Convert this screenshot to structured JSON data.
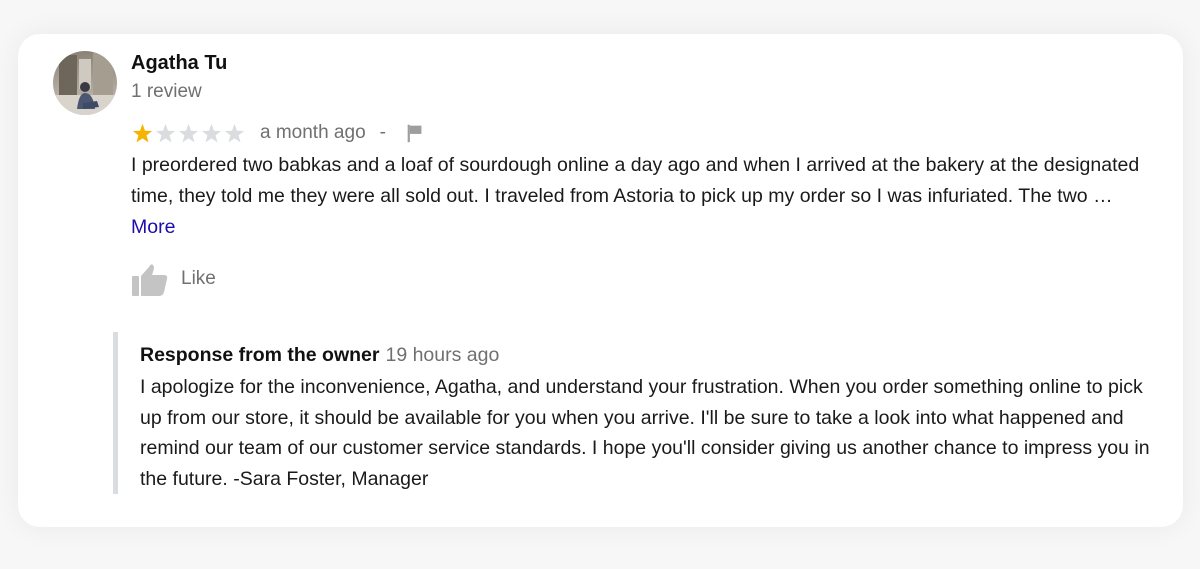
{
  "review": {
    "author": "Agatha Tu",
    "review_count": "1 review",
    "rating": 1,
    "max_rating": 5,
    "time": "a month ago",
    "separator": "-",
    "text": "I preordered two babkas and a loaf of sourdough online a day ago and when I arrived at the bakery at the designated time, they told me they were all sold out. I traveled from Astoria to pick up my order so I was infuriated. The two … ",
    "more_label": "More",
    "like_label": "Like"
  },
  "owner_response": {
    "title": "Response from the owner",
    "time": "19 hours ago",
    "text": "I apologize for the inconvenience, Agatha, and understand your frustration. When you order something online to pick up from our store, it should be available for you when you arrive. I'll be sure to take a look into what happened and remind our team of our customer service standards. I hope you'll consider giving us another chance to impress you in the future. -Sara Foster, Manager"
  },
  "colors": {
    "star_filled": "#f4b400",
    "star_empty": "#dadce0",
    "link": "#1a0dab",
    "muted_text": "#707070",
    "response_bar": "#dadce0"
  },
  "icons": {
    "avatar": "user-photo",
    "flag": "flag-icon",
    "like": "thumbs-up-icon"
  }
}
